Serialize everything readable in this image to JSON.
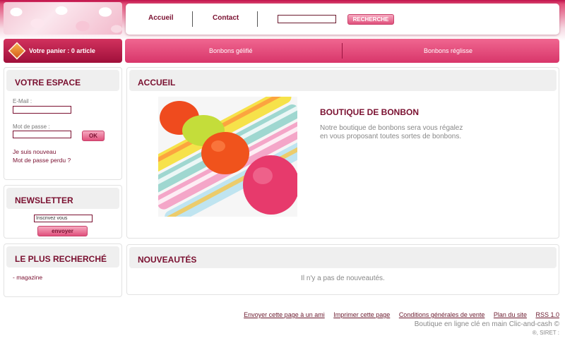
{
  "header": {
    "nav": [
      "Accueil",
      "Contact"
    ],
    "search": {
      "value": "",
      "button": "RECHERCHE"
    }
  },
  "cart": {
    "label": "Votre panier : 0 article"
  },
  "categories": [
    "Bonbons gélifié",
    "Bonbons réglisse"
  ],
  "sidebar": {
    "account": {
      "title": "VOTRE ESPACE",
      "email_label": "E-Mail :",
      "password_label": "Mot de passe :",
      "ok_button": "OK",
      "new_link": "Je suis nouveau",
      "forgot_link": "Mot de passe perdu ?"
    },
    "newsletter": {
      "title": "NEWSLETTER",
      "input_value": "Inscrivez vous",
      "button": "envoyer"
    },
    "most_searched": {
      "title": "LE PLUS RECHERCHÉ",
      "items": [
        "- magazine"
      ]
    }
  },
  "main": {
    "title": "ACCUEIL",
    "heading": "BOUTIQUE DE BONBON",
    "text_line1": "Notre boutique de bonbons sera vous régalez",
    "text_line2": "en vous proposant toutes sortes de bonbons."
  },
  "news": {
    "title": "NOUVEAUTÉS",
    "empty_text": "Il n'y a pas de nouveautés."
  },
  "footer": {
    "links": [
      "Envoyer cette page à un ami",
      "Imprimer cette page",
      "Conditions générales de vente",
      "Plan du site",
      "RSS 1.0"
    ],
    "line1": "Boutique en ligne clé en main Clic-and-cash ©",
    "line2": "®, SIRET :"
  },
  "colors": {
    "brand": "#7a1030",
    "pink": "#e0507c",
    "header_red": "#c0124a"
  }
}
